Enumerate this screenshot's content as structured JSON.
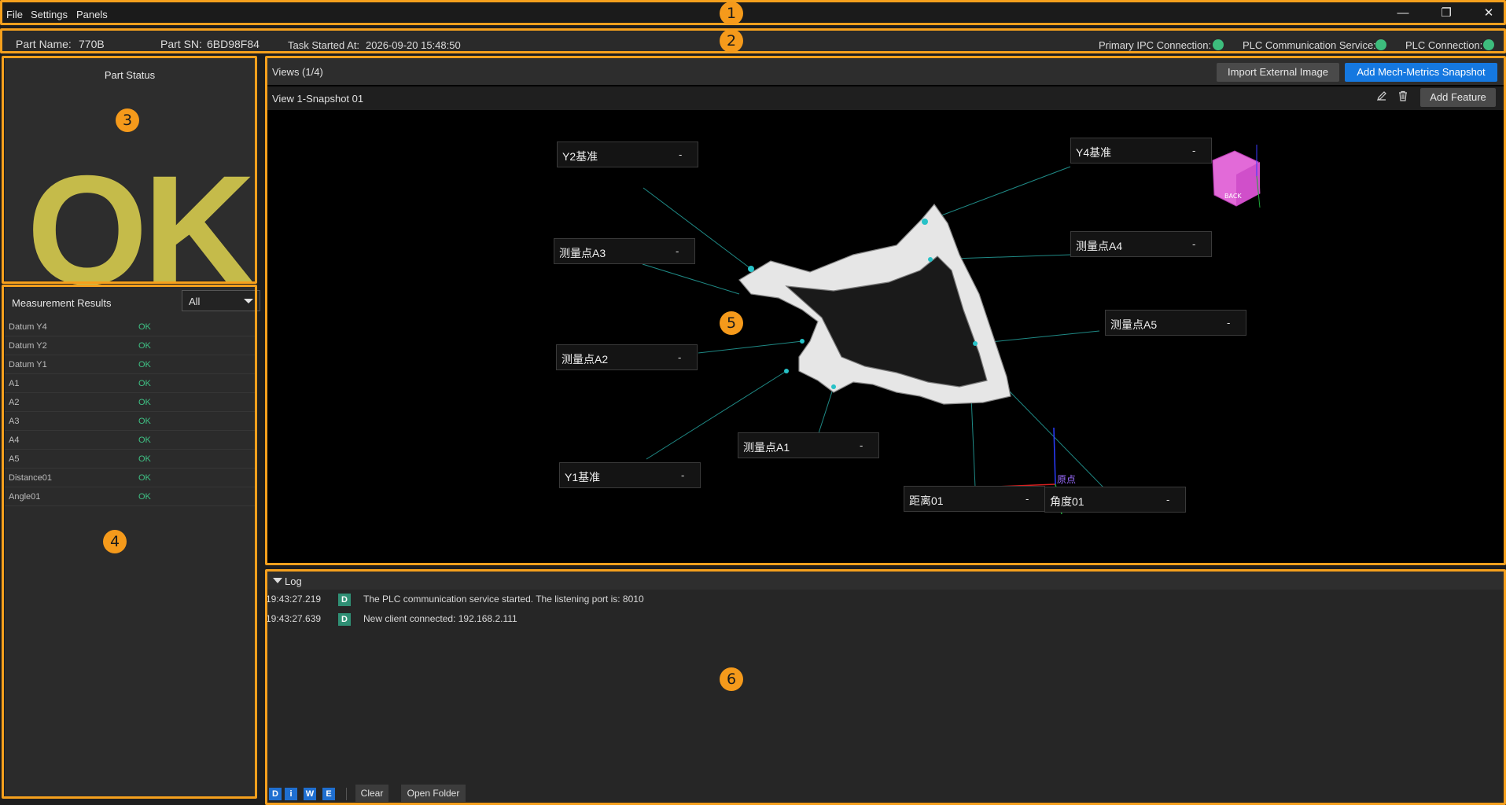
{
  "menu": {
    "file": "File",
    "settings": "Settings",
    "panels": "Panels"
  },
  "window_controls": {
    "minimize": "—",
    "restore": "❐",
    "close": "✕"
  },
  "infobar": {
    "part_name_label": "Part Name:",
    "part_name": "770B",
    "part_sn_label": "Part SN:",
    "part_sn": "6BD98F84",
    "task_started_label": "Task Started At:",
    "task_started": "2026-09-20 15:48:50",
    "primary_ipc_label": "Primary IPC Connection:",
    "plc_comm_label": "PLC Communication Service:",
    "plc_conn_label": "PLC Connection:",
    "status_color": "#3dbd7d"
  },
  "part_status": {
    "title": "Part Status",
    "value": "OK",
    "color": "#c5bb4a"
  },
  "results": {
    "title": "Measurement Results",
    "filter": "All",
    "rows": [
      {
        "name": "Datum Y4",
        "value": "OK"
      },
      {
        "name": "Datum Y2",
        "value": "OK"
      },
      {
        "name": "Datum Y1",
        "value": "OK"
      },
      {
        "name": "A1",
        "value": "OK"
      },
      {
        "name": "A2",
        "value": "OK"
      },
      {
        "name": "A3",
        "value": "OK"
      },
      {
        "name": "A4",
        "value": "OK"
      },
      {
        "name": "A5",
        "value": "OK"
      },
      {
        "name": "Distance01",
        "value": "OK"
      },
      {
        "name": "Angle01",
        "value": "OK"
      }
    ]
  },
  "views": {
    "title": "Views (1/4)",
    "import_button": "Import External Image",
    "add_snapshot_button": "Add Mech-Metrics Snapshot",
    "snapshot_title": "View 1-Snapshot 01",
    "add_feature_button": "Add Feature",
    "origin_label": "原点",
    "cube_front": "BACK",
    "callouts": [
      {
        "label": "Y2基准",
        "value": "-"
      },
      {
        "label": "Y4基准",
        "value": "-"
      },
      {
        "label": "测量点A3",
        "value": "-"
      },
      {
        "label": "测量点A4",
        "value": "-"
      },
      {
        "label": "测量点A5",
        "value": "-"
      },
      {
        "label": "测量点A2",
        "value": "-"
      },
      {
        "label": "测量点A1",
        "value": "-"
      },
      {
        "label": "Y1基准",
        "value": "-"
      },
      {
        "label": "距离01",
        "value": "-"
      },
      {
        "label": "角度01",
        "value": "-"
      }
    ]
  },
  "log": {
    "title": "Log",
    "lines": [
      {
        "time": "19:43:27.219",
        "level": "D",
        "message": "The PLC communication service started. The listening port is: 8010"
      },
      {
        "time": "19:43:27.639",
        "level": "D",
        "message": "New client connected: 192.168.2.111"
      }
    ],
    "level_buttons": [
      "D",
      "i",
      "W",
      "E"
    ],
    "clear_button": "Clear",
    "open_folder_button": "Open Folder"
  },
  "annotations": [
    "1",
    "2",
    "3",
    "4",
    "5",
    "6"
  ]
}
